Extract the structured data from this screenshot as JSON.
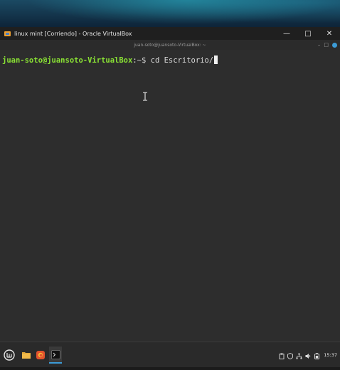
{
  "host_window": {
    "title": "linux mint [Corriendo] - Oracle VirtualBox",
    "controls": {
      "minimize": "—",
      "maximize": "□",
      "close": "✕"
    }
  },
  "terminal": {
    "title": "juan-soto@juansoto-VirtualBox: ~",
    "title_controls": {
      "minimize": "–",
      "maximize": "□"
    },
    "prompt_user": "juan-soto@juansoto-VirtualBox",
    "prompt_sep": ":~$ ",
    "command": "cd Escritorio/"
  },
  "taskbar": {
    "items": [
      {
        "name": "menu-icon"
      },
      {
        "name": "files-icon"
      },
      {
        "name": "firefox-icon"
      },
      {
        "name": "terminal-icon"
      }
    ],
    "tray_icons": [
      "clipboard-icon",
      "shield-icon",
      "network-icon",
      "volume-icon",
      "battery-icon"
    ],
    "clock": "15:37"
  },
  "colors": {
    "prompt_user": "#8ae234",
    "terminal_bg": "#2d2d2d",
    "accent": "#3c9bd6"
  }
}
